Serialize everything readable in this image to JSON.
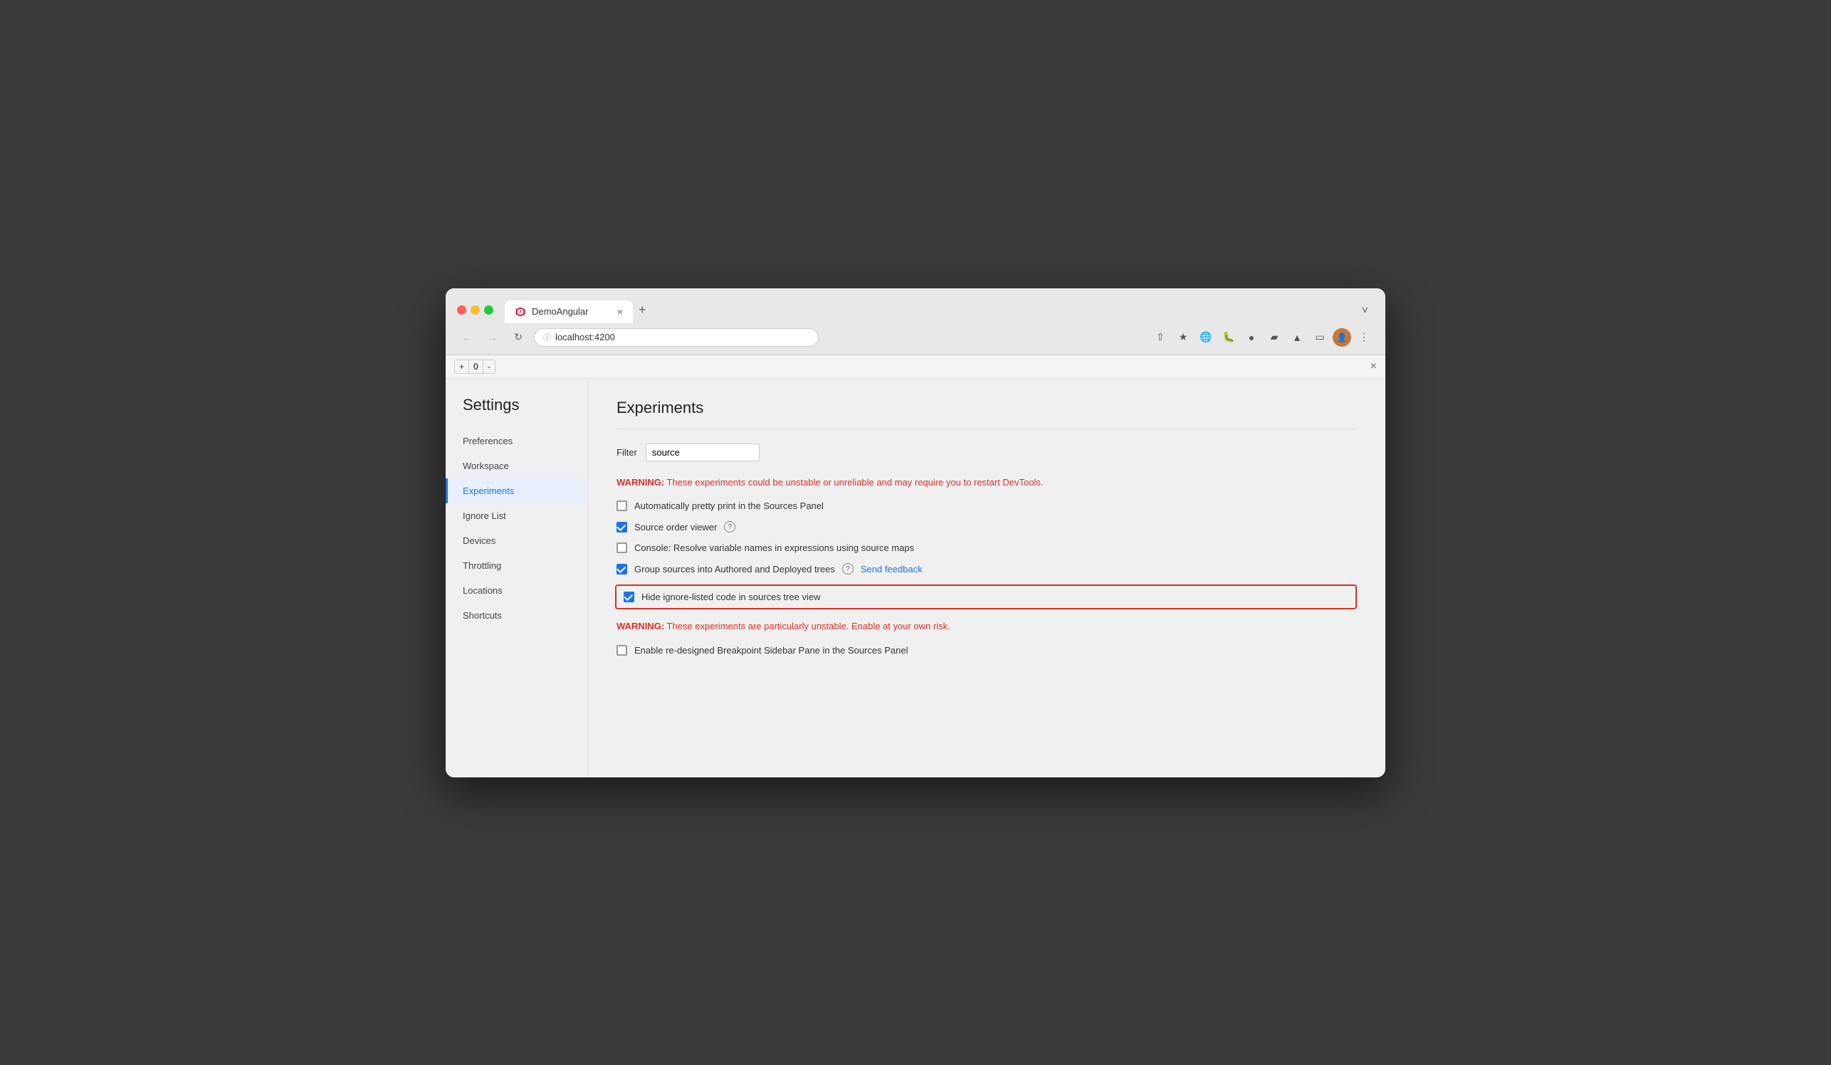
{
  "browser": {
    "tab_title": "DemoAngular",
    "tab_close_label": "×",
    "tab_new_label": "+",
    "tab_collapse_label": "˅",
    "url": "localhost:4200",
    "nav_back_label": "←",
    "nav_forward_label": "→",
    "nav_reload_label": "↻",
    "actions": [
      "share",
      "bookmark",
      "earth",
      "bug",
      "angular",
      "puzzle",
      "flask",
      "layout",
      "avatar",
      "menu"
    ]
  },
  "devtools": {
    "counter_minus": "-",
    "counter_value": "0",
    "counter_plus": "+",
    "close_label": "×"
  },
  "settings": {
    "title": "Settings",
    "nav_items": [
      {
        "id": "preferences",
        "label": "Preferences",
        "active": false
      },
      {
        "id": "workspace",
        "label": "Workspace",
        "active": false
      },
      {
        "id": "experiments",
        "label": "Experiments",
        "active": true
      },
      {
        "id": "ignore-list",
        "label": "Ignore List",
        "active": false
      },
      {
        "id": "devices",
        "label": "Devices",
        "active": false
      },
      {
        "id": "throttling",
        "label": "Throttling",
        "active": false
      },
      {
        "id": "locations",
        "label": "Locations",
        "active": false
      },
      {
        "id": "shortcuts",
        "label": "Shortcuts",
        "active": false
      }
    ]
  },
  "experiments": {
    "title": "Experiments",
    "filter_label": "Filter",
    "filter_value": "source",
    "warning1": "WARNING:",
    "warning1_text": " These experiments could be unstable or unreliable and may require you to restart DevTools.",
    "checkbox1_label": "Automatically pretty print in the Sources Panel",
    "checkbox1_checked": false,
    "checkbox2_label": "Source order viewer",
    "checkbox2_checked": true,
    "checkbox3_label": "Console: Resolve variable names in expressions using source maps",
    "checkbox3_checked": false,
    "checkbox4_label": "Group sources into Authored and Deployed trees",
    "checkbox4_checked": true,
    "send_feedback_label": "Send feedback",
    "checkbox5_label": "Hide ignore-listed code in sources tree view",
    "checkbox5_checked": true,
    "warning2": "WARNING:",
    "warning2_text": " These experiments are particularly unstable. Enable at your own risk.",
    "checkbox6_label": "Enable re-designed Breakpoint Sidebar Pane in the Sources Panel",
    "checkbox6_checked": false
  }
}
